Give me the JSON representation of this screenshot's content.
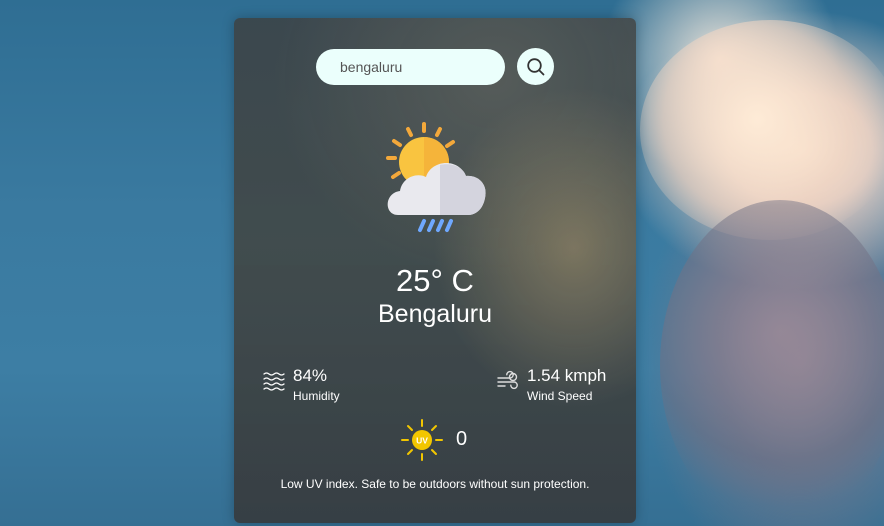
{
  "search": {
    "value": "bengaluru",
    "placeholder": ""
  },
  "weather": {
    "icon": "sun-cloud-rain-icon",
    "temperature": "25° C",
    "city": "Bengaluru"
  },
  "details": {
    "humidity": {
      "icon": "humidity-waves-icon",
      "value": "84%",
      "label": "Humidity"
    },
    "wind": {
      "icon": "wind-icon",
      "value": "1.54 kmph",
      "label": "Wind Speed"
    }
  },
  "uv": {
    "icon": "uv-sun-icon",
    "icon_text": "UV",
    "value": "0",
    "message": "Low UV index. Safe to be outdoors without sun protection."
  },
  "colors": {
    "input_background": "#ebfffc",
    "sun": "#f5c518",
    "sun_ray": "#f3a83b",
    "uv_sun": "#f2c600",
    "text": "#ffffff"
  }
}
